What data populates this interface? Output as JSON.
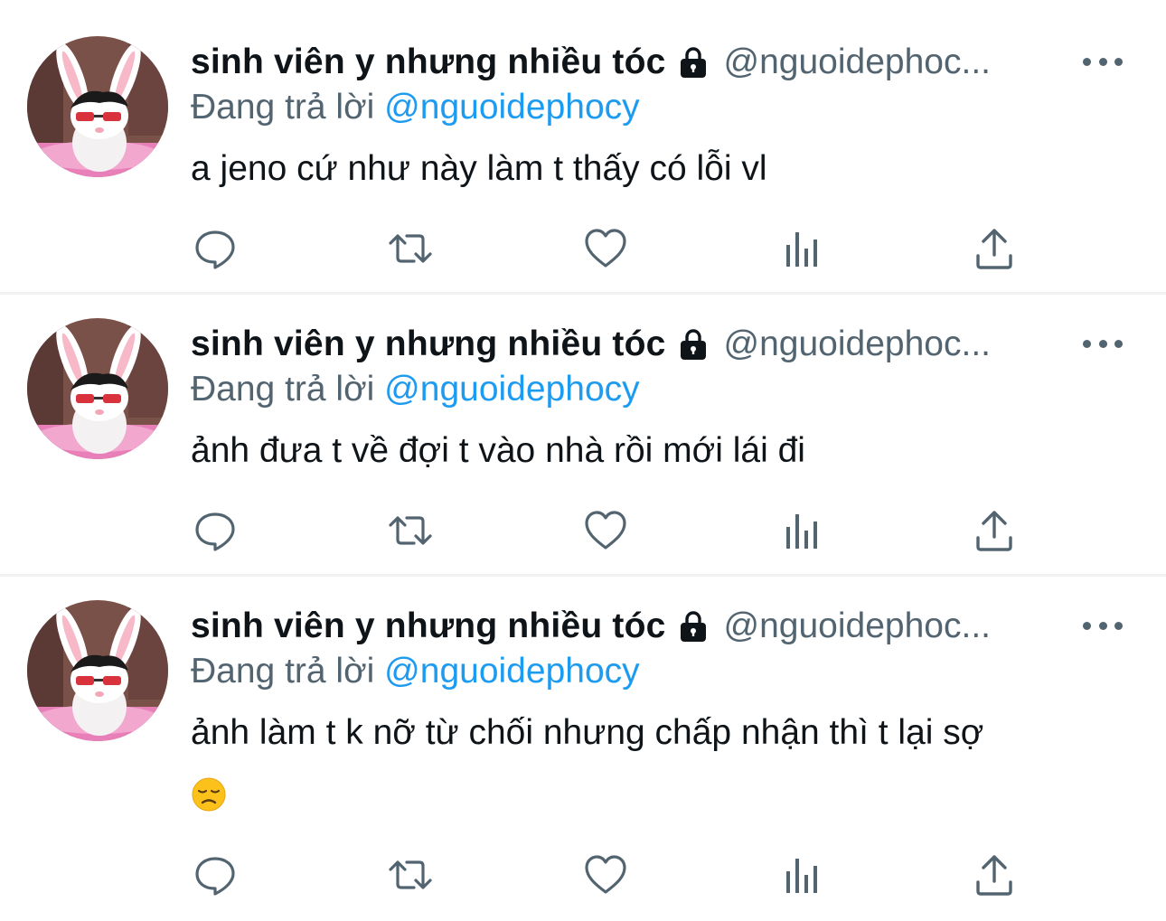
{
  "tweets": [
    {
      "display_name": "sinh viên y nhưng nhiều tóc",
      "handle": "@nguoidephoc...",
      "reply_prefix": "Đang trả lời",
      "reply_mention": "@nguoidephocy",
      "text": "a jeno cứ như này làm t thấy có lỗi vl",
      "emoji": ""
    },
    {
      "display_name": "sinh viên y nhưng nhiều tóc",
      "handle": "@nguoidephoc...",
      "reply_prefix": "Đang trả lời",
      "reply_mention": "@nguoidephocy",
      "text": "ảnh đưa t về đợi t vào nhà rồi mới lái đi",
      "emoji": ""
    },
    {
      "display_name": "sinh viên y nhưng nhiều tóc",
      "handle": "@nguoidephoc...",
      "reply_prefix": "Đang trả lời",
      "reply_mention": "@nguoidephocy",
      "text": "ảnh làm t k nỡ từ chối nhưng chấp nhận thì t lại sợ",
      "emoji": "disappointed-face-emoji"
    }
  ],
  "icons": {
    "lock": "lock-icon",
    "more": "more-icon",
    "reply": "reply-icon",
    "retweet": "retweet-icon",
    "like": "heart-icon",
    "views": "analytics-icon",
    "share": "share-icon"
  },
  "colors": {
    "text": "#0f1419",
    "secondary": "#536471",
    "mention": "#1d9bf0",
    "divider": "#eff1f3"
  }
}
